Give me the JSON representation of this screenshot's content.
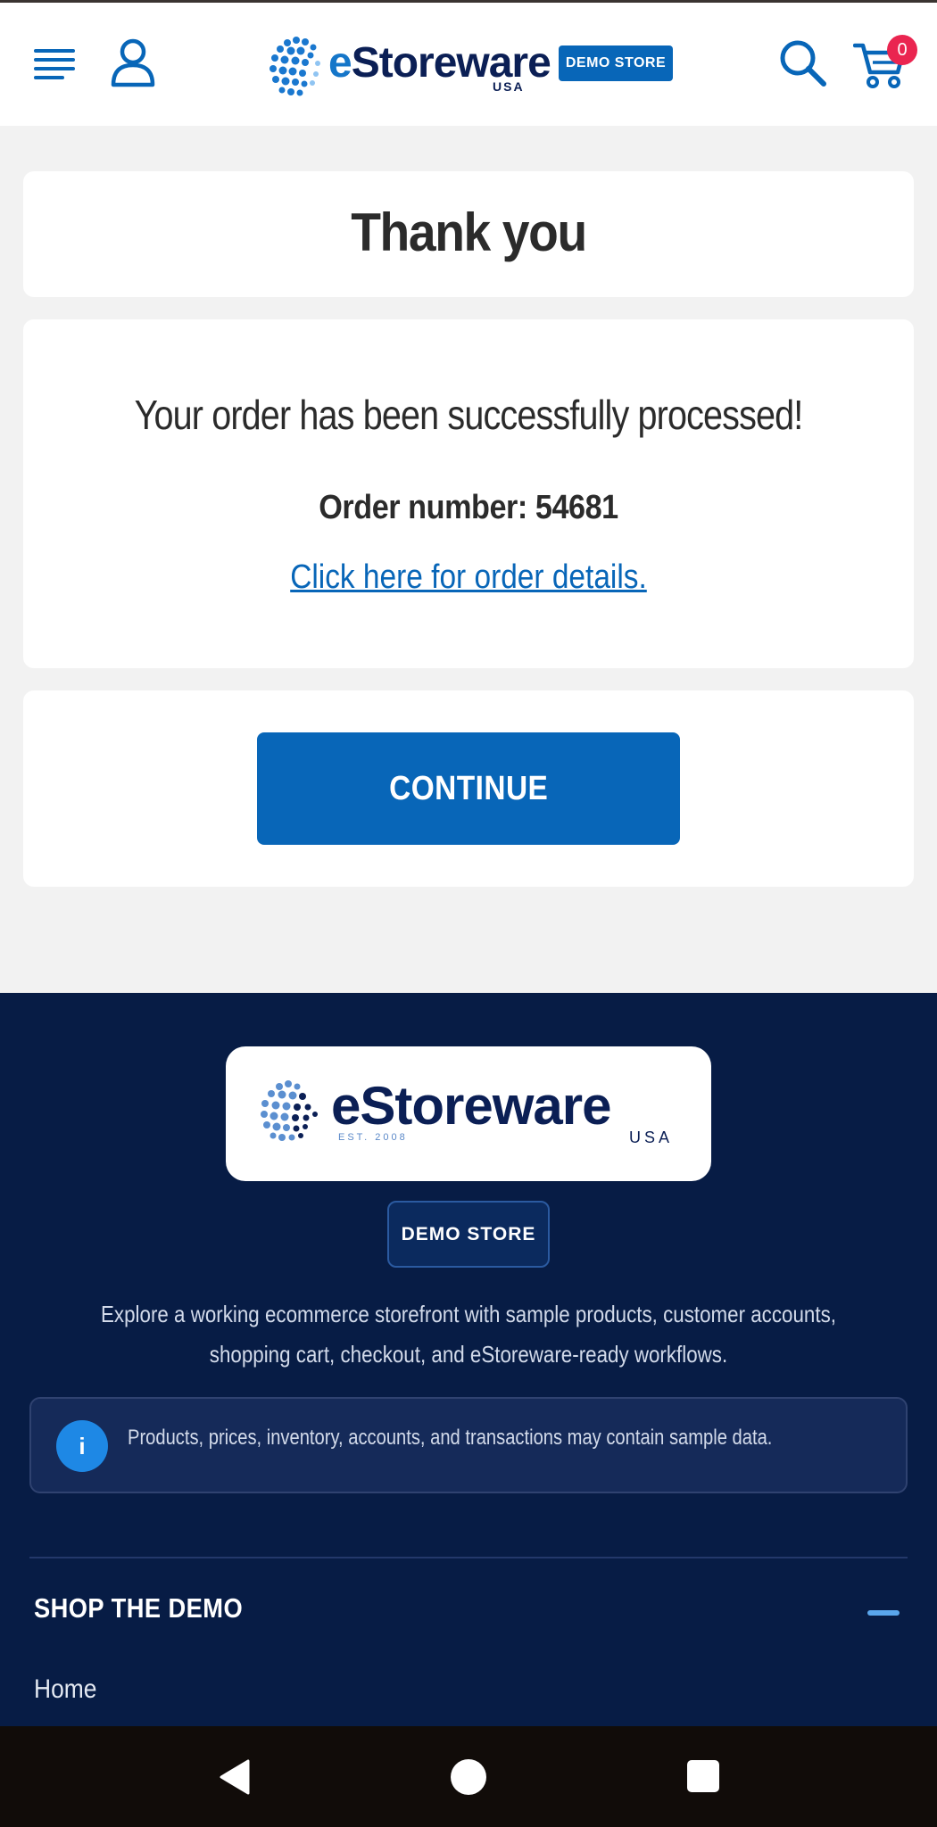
{
  "header": {
    "logo_text_main": "Storeware",
    "logo_text_e": "e",
    "logo_sub": "USA",
    "logo_badge": "DEMO STORE",
    "cart_count": "0"
  },
  "thank_you": {
    "title": "Thank you"
  },
  "order": {
    "success_message": "Your order has been successfully processed!",
    "order_number_label": "Order number: 54681",
    "details_link": "Click here for order details."
  },
  "continue": {
    "label": "CONTINUE"
  },
  "footer": {
    "logo_text_main": "Storeware",
    "logo_text_e": "e",
    "logo_est": "EST. 2008",
    "logo_sub": "USA",
    "badge": "DEMO STORE",
    "description": "Explore a working ecommerce storefront with sample products, customer accounts, shopping cart, checkout, and eStoreware-ready workflows.",
    "notice_icon": "i",
    "notice_text": "Products, prices, inventory, accounts, and transactions may contain sample data.",
    "shop_heading": "SHOP THE DEMO",
    "shop_items": [
      "Home"
    ]
  },
  "colors": {
    "brand_blue": "#0866b8",
    "footer_navy": "#071c45",
    "cart_badge": "#ea2550"
  },
  "icons": [
    "menu-icon",
    "user-icon",
    "search-icon",
    "cart-icon",
    "info-icon",
    "back-nav-icon",
    "home-nav-icon",
    "recents-nav-icon"
  ]
}
